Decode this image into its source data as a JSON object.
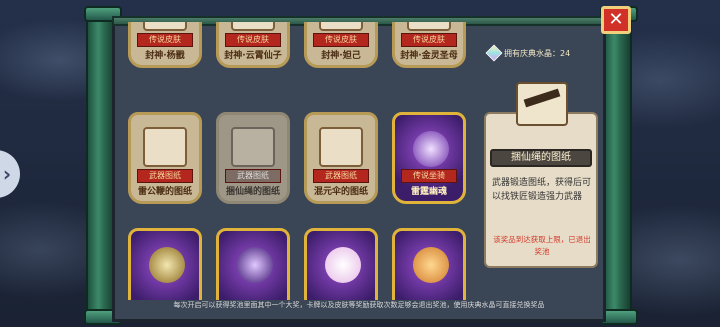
{
  "nav": {
    "prev_arrow": "›"
  },
  "header": {
    "crystal_label": "拥有庆典水晶：24",
    "close_label": "✕"
  },
  "cards": [
    {
      "name": "封神·杨戬",
      "badge": "传说皮肤",
      "style": "plain"
    },
    {
      "name": "封神·云霄仙子",
      "badge": "传说皮肤",
      "style": "plain"
    },
    {
      "name": "封神·妲己",
      "badge": "传说皮肤",
      "style": "plain"
    },
    {
      "name": "封神·金灵圣母",
      "badge": "传说皮肤",
      "style": "plain"
    },
    {
      "name": "雷公鞭的图纸",
      "badge": "武器图纸",
      "style": "plain"
    },
    {
      "name": "捆仙绳的图纸",
      "badge": "武器图纸",
      "style": "dim"
    },
    {
      "name": "混元伞的图纸",
      "badge": "武器图纸",
      "style": "plain"
    },
    {
      "name": "雷霆幽魂",
      "badge": "传说坐骑",
      "style": "gold"
    },
    {
      "name": "",
      "badge": "",
      "style": "gold"
    },
    {
      "name": "",
      "badge": "",
      "style": "gold"
    },
    {
      "name": "",
      "badge": "",
      "style": "gold"
    },
    {
      "name": "",
      "badge": "",
      "style": "gold"
    }
  ],
  "detail": {
    "title": "捆仙绳的图纸",
    "description": "武器锻造图纸，获得后可以找铁匠锻造强力武器",
    "note": "该奖品到达获取上限，已退出奖池"
  },
  "footer": {
    "text": "每次开启可以获得奖池里面其中一个大奖，卡牌以及皮肤等奖励获取次数足够会退出奖池，使用庆典水晶可直接兑换奖品"
  },
  "colors": {
    "panel_bg": "#3a4655",
    "accent_red": "#d23127",
    "note_red": "#d23a2a",
    "gold_border": "#caa24a"
  }
}
